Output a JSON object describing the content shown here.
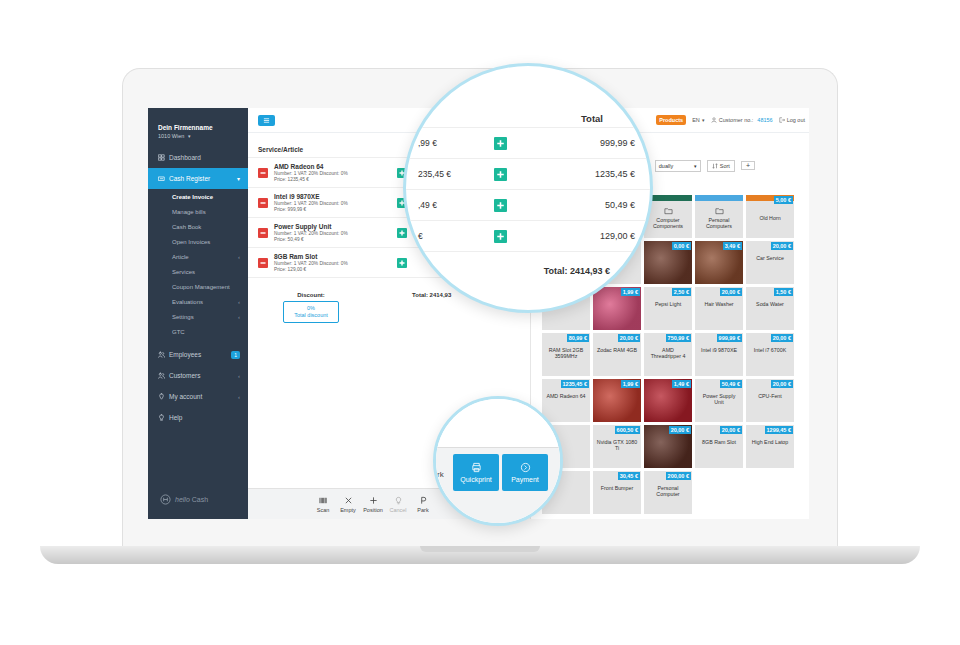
{
  "sidebar": {
    "company": "Dein Firmenname",
    "city": "1010 Wien",
    "city_caret": "▾",
    "items": [
      {
        "label": "Dashboard",
        "selected": false,
        "expanded": false
      },
      {
        "label": "Cash Register",
        "selected": true,
        "expanded": true,
        "chevron": "▾",
        "children": [
          {
            "label": "Create Invoice",
            "selected": true
          },
          {
            "label": "Manage bills",
            "selected": false
          },
          {
            "label": "Cash Book",
            "selected": false
          },
          {
            "label": "Open Invoices",
            "selected": false
          },
          {
            "label": "Article",
            "selected": false,
            "chevron": "‹"
          },
          {
            "label": "Services",
            "selected": false
          },
          {
            "label": "Coupon Management",
            "selected": false
          },
          {
            "label": "Evaluations",
            "selected": false,
            "chevron": "‹"
          },
          {
            "label": "Settings",
            "selected": false,
            "chevron": "‹"
          },
          {
            "label": "GTC",
            "selected": false
          }
        ]
      },
      {
        "label": "Employees",
        "selected": false,
        "expanded": false,
        "badge": "1"
      },
      {
        "label": "Customers",
        "selected": false,
        "expanded": false,
        "chevron": "‹"
      },
      {
        "label": "My account",
        "selected": false,
        "expanded": false,
        "chevron": "‹"
      },
      {
        "label": "Help",
        "selected": false,
        "expanded": false
      }
    ],
    "logo_a": "hello",
    "logo_b": "Cash"
  },
  "topbar": {
    "products": "Products",
    "language": "EN",
    "language_caret": "▾",
    "customer_label": "Customer no.:",
    "customer_no": "48156",
    "logout": "Log out"
  },
  "cart": {
    "header": "Service/Article",
    "rows": [
      {
        "name": "AMD Radeon 64",
        "details": "Number: 1 VAT: 20% Discount: 0%",
        "price": "Price: 1235,45 €"
      },
      {
        "name": "Intel i9 9870XE",
        "details": "Number: 1 VAT: 20% Discount: 0%",
        "price": "Price: 999,99 €"
      },
      {
        "name": "Power Supply Unit",
        "details": "Number: 1 VAT: 20% Discount: 0%",
        "price": "Price: 50,49 €"
      },
      {
        "name": "8GB Ram Slot",
        "details": "Number: 1 VAT: 20% Discount: 0%",
        "price": "Price: 129,00 €"
      }
    ],
    "discount_label": "Discount:",
    "discount_value": "0%",
    "discount_caption": "Total discount",
    "total": "Total: 2414,93"
  },
  "toolbar": [
    {
      "label": "Scan",
      "disabled": false
    },
    {
      "label": "Empty",
      "disabled": false
    },
    {
      "label": "Position",
      "disabled": false
    },
    {
      "label": "Cancel",
      "disabled": true
    },
    {
      "label": "Park",
      "disabled": false
    }
  ],
  "products": {
    "sort_select": "dually",
    "select_caret": "▾",
    "sort_button": "Sort",
    "add_button": "+",
    "tiles": [
      {
        "kind": "blank"
      },
      {
        "kind": "blank"
      },
      {
        "kind": "folder",
        "name": "Computer Components",
        "color": "#1f6f55"
      },
      {
        "kind": "folder",
        "name": "Personal Computers",
        "color": "#4aa8e0"
      },
      {
        "kind": "product",
        "name": "Old Horn",
        "price": "5,00 €",
        "color": "#e67e22"
      },
      {
        "kind": "blank"
      },
      {
        "kind": "blank"
      },
      {
        "kind": "photo",
        "price": "0,00 €",
        "color": "#6e3b2b"
      },
      {
        "kind": "photo",
        "price": "3,49 €",
        "color": "#8a4b2f"
      },
      {
        "kind": "product",
        "name": "Car Service",
        "price": "20,00 €"
      },
      {
        "kind": "blank"
      },
      {
        "kind": "photo",
        "price": "1,99 €",
        "color": "#d64f7a"
      },
      {
        "kind": "product",
        "name": "Pepsi Light",
        "price": "2,50 €"
      },
      {
        "kind": "product",
        "name": "Hair Washer",
        "price": "20,00 €"
      },
      {
        "kind": "product",
        "name": "Soda Water",
        "price": "1,50 €"
      },
      {
        "kind": "product",
        "name": "RAM Slot 2GB 3599MHz",
        "price": "80,99 €"
      },
      {
        "kind": "product",
        "name": "Zodac RAM 4GB",
        "price": "20,00 €"
      },
      {
        "kind": "product",
        "name": "AMD Threadripper 4",
        "price": "750,99 €"
      },
      {
        "kind": "product",
        "name": "Intel i9 9870XE",
        "price": "999,99 €"
      },
      {
        "kind": "product",
        "name": "Intel i7 6700K",
        "price": "20,00 €"
      },
      {
        "kind": "product",
        "name": "AMD Radeon 64",
        "price": "1235,45 €"
      },
      {
        "kind": "photo",
        "price": "1,99 €",
        "color": "#c0392b"
      },
      {
        "kind": "photo",
        "price": "1,49 €",
        "color": "#b3202c"
      },
      {
        "kind": "product",
        "name": "Power Supply Unit",
        "price": "50,49 €"
      },
      {
        "kind": "product",
        "name": "CPU-Fent",
        "price": "20,00 €"
      },
      {
        "kind": "blank"
      },
      {
        "kind": "product",
        "name": "Nvidia GTX 1080 Ti",
        "price": "600,50 €"
      },
      {
        "kind": "photo",
        "price": "20,00 €",
        "color": "#5b2f24"
      },
      {
        "kind": "product",
        "name": "8GB Ram Slot",
        "price": "20,00 €"
      },
      {
        "kind": "product",
        "name": "High End Latop",
        "price": "1299,45 €"
      },
      {
        "kind": "blank"
      },
      {
        "kind": "product",
        "name": "Front Bumper",
        "price": "30,45 €"
      },
      {
        "kind": "product",
        "name": "Personal Computer",
        "price": "200,00 €"
      }
    ]
  },
  "zoom_total": {
    "header": "Total",
    "rows": [
      {
        "fragment": ",99 €",
        "price": "999,99 €"
      },
      {
        "fragment": "235,45 €",
        "price": "1235,45 €"
      },
      {
        "fragment": ",49 €",
        "price": "50,49 €"
      },
      {
        "fragment": "€",
        "price": "129,00 €"
      }
    ],
    "total": "Total: 2414,93 €"
  },
  "zoom_buttons": {
    "fragment": "rk",
    "buttons": [
      "Quickprint",
      "Payment"
    ]
  }
}
